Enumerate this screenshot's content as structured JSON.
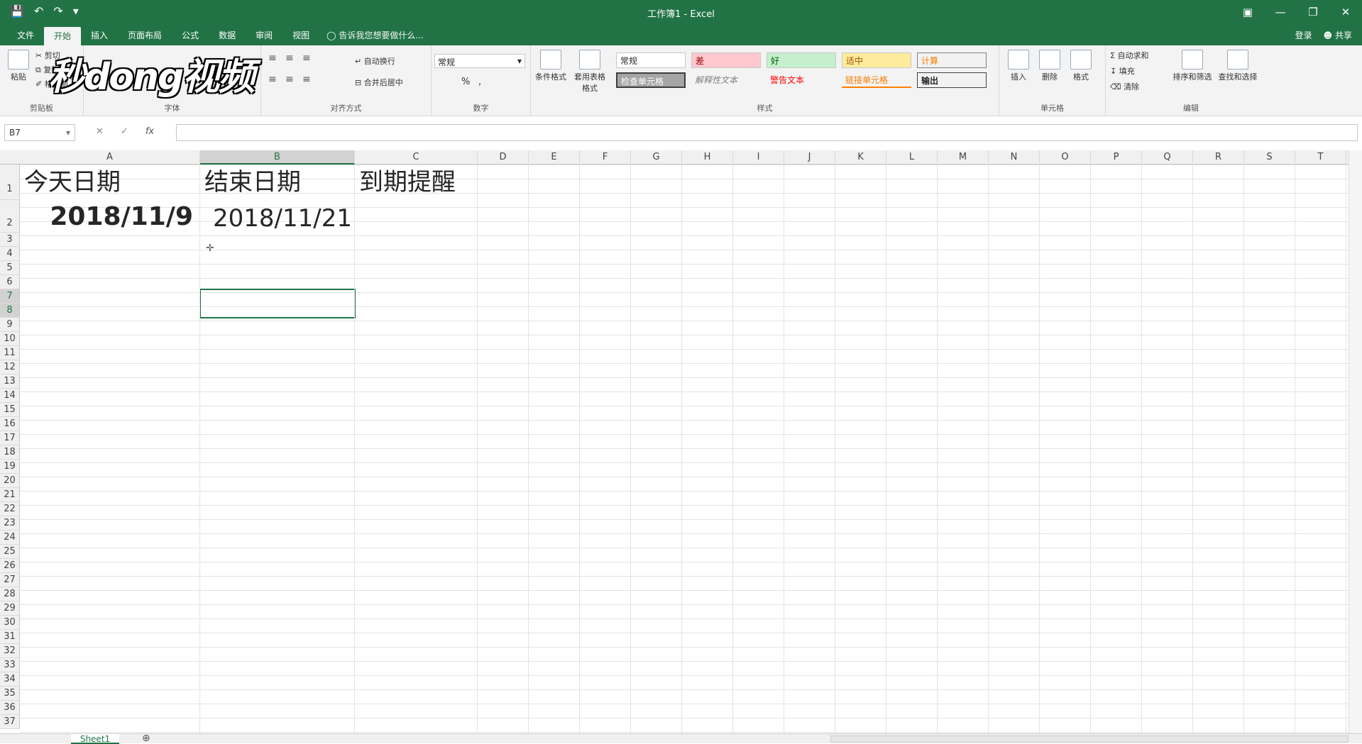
{
  "title_bar": {
    "document_title": "工作簿1 - Excel",
    "quick_access": [
      "save-icon",
      "undo-icon",
      "redo-icon",
      "customize-icon"
    ]
  },
  "ribbon_tabs": [
    "文件",
    "开始",
    "插入",
    "页面布局",
    "公式",
    "数据",
    "审阅",
    "视图"
  ],
  "active_tab": "开始",
  "tell_me": "告诉我您想要做什么...",
  "account": {
    "login": "登录",
    "share": "共享"
  },
  "ribbon": {
    "clipboard": {
      "label": "剪贴板",
      "paste": "粘贴",
      "cut": "剪切",
      "copy": "复制",
      "format_painter": "格式刷"
    },
    "font": {
      "label": "字体"
    },
    "alignment": {
      "label": "对齐方式",
      "wrap": "自动换行",
      "merge": "合并后居中"
    },
    "number": {
      "label": "数字",
      "format": "常规",
      "percent": "%",
      "comma": ","
    },
    "styles": {
      "label": "样式",
      "conditional": "条件格式",
      "table_format": "套用表格格式",
      "items": [
        "常规",
        "差",
        "好",
        "适中",
        "计算",
        "检查单元格",
        "解释性文本",
        "警告文本",
        "链接单元格",
        "输出"
      ]
    },
    "cells": {
      "label": "单元格",
      "insert": "插入",
      "delete": "删除",
      "format": "格式"
    },
    "editing": {
      "label": "编辑",
      "autosum": "自动求和",
      "fill": "填充",
      "clear": "清除",
      "sort": "排序和筛选",
      "find": "查找和选择"
    }
  },
  "formula_bar": {
    "name_box": "B7",
    "fx": "fx",
    "content": ""
  },
  "columns": [
    "A",
    "B",
    "C",
    "D",
    "E",
    "F",
    "G",
    "H",
    "I",
    "J",
    "K",
    "L",
    "M",
    "N",
    "O",
    "P",
    "Q",
    "R",
    "S",
    "T"
  ],
  "rows": [
    "1",
    "2",
    "3",
    "4",
    "5",
    "6",
    "7",
    "8",
    "9",
    "10",
    "11",
    "12",
    "13",
    "14",
    "15",
    "16",
    "17",
    "18",
    "19",
    "20",
    "21",
    "22",
    "23",
    "24",
    "25",
    "26",
    "27",
    "28",
    "29",
    "30",
    "31",
    "32",
    "33",
    "34",
    "35",
    "36",
    "37"
  ],
  "cells": {
    "A1": "今天日期",
    "B1": "结束日期",
    "C1": "到期提醒",
    "A2": "2018/11/9",
    "B2": "2018/11/21"
  },
  "selected_cell": "B7",
  "sheet_tabs": [
    "Sheet1"
  ],
  "watermark": "秒dong视频",
  "colors": {
    "accent": "#217346",
    "ribbon_bg": "#f3f3f3"
  }
}
